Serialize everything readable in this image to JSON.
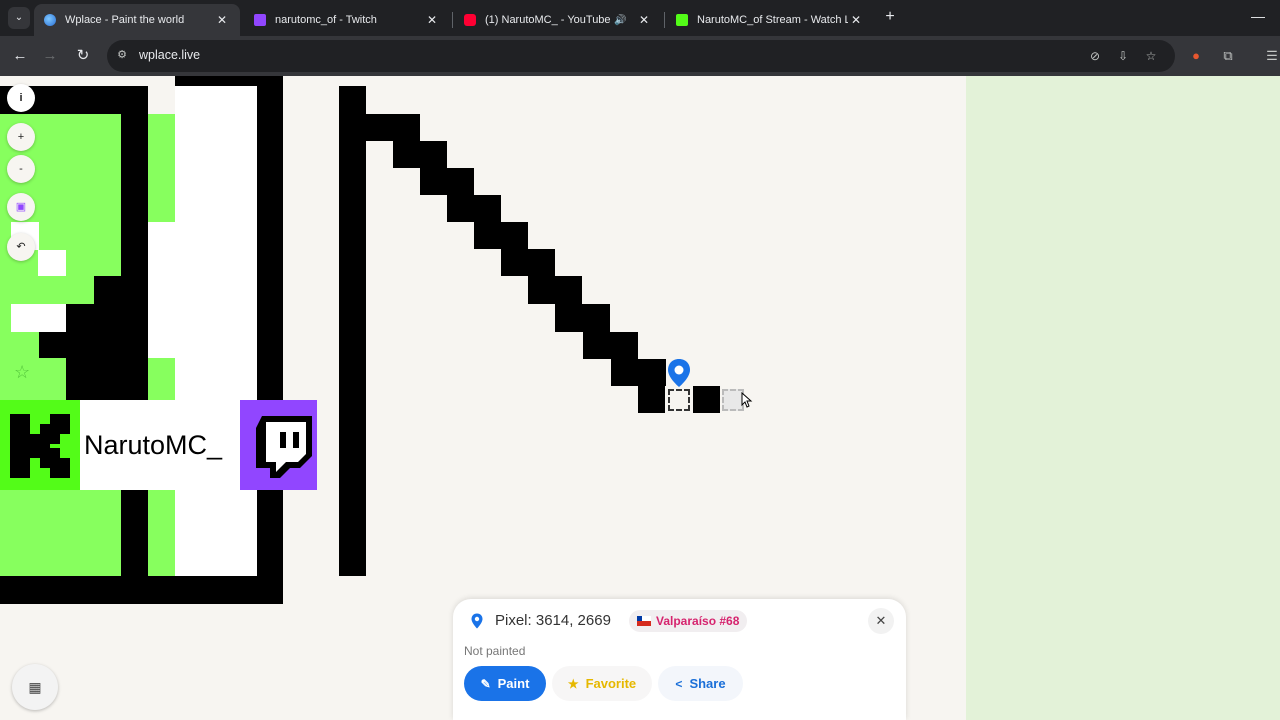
{
  "browser": {
    "tabs": [
      {
        "title": "Wplace - Paint the world",
        "favicon": "globe-icon",
        "active": true
      },
      {
        "title": "narutomc_of - Twitch",
        "favicon": "twitch-icon",
        "active": false
      },
      {
        "title": "(1) NarutoMC_ - YouTube",
        "favicon": "youtube-icon",
        "active": false,
        "audio": true
      },
      {
        "title": "NarutoMC_of Stream - Watch L",
        "favicon": "kick-icon",
        "active": false
      }
    ],
    "url": "wplace.live",
    "colors": {
      "tabbar": "#202124",
      "toolbar": "#35363a"
    }
  },
  "canvas": {
    "banner_name": "NarutoMC_",
    "colors": {
      "background": "#f7f5f1",
      "green": "#87ff5e",
      "black": "#000000",
      "twitch": "#9146ff",
      "kick": "#53fc18"
    }
  },
  "controls": {
    "info": "i",
    "zoom_in": "+",
    "zoom_out": "-"
  },
  "pixel_panel": {
    "coords": "Pixel: 3614, 2669",
    "region": "Valparaíso #68",
    "status": "Not painted",
    "paint_label": "Paint",
    "favorite_label": "Favorite",
    "share_label": "Share",
    "accent": "#1a73e8"
  }
}
